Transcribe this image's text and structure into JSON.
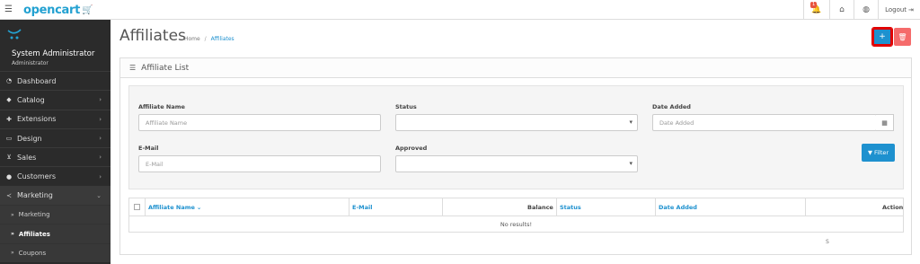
{
  "header": {
    "logo_text": "opencart",
    "notification_count": "1",
    "logout_label": "Logout"
  },
  "sidebar": {
    "profile_name": "System Administrator",
    "profile_role": "Administrator",
    "items": [
      {
        "label": "Dashboard",
        "icon": "dashboard-icon"
      },
      {
        "label": "Catalog",
        "icon": "tag-icon"
      },
      {
        "label": "Extensions",
        "icon": "puzzle-icon"
      },
      {
        "label": "Design",
        "icon": "monitor-icon"
      },
      {
        "label": "Sales",
        "icon": "cart-icon"
      },
      {
        "label": "Customers",
        "icon": "user-icon"
      },
      {
        "label": "Marketing",
        "icon": "share-icon"
      }
    ],
    "sub_items": [
      {
        "label": "Marketing"
      },
      {
        "label": "Affiliates"
      },
      {
        "label": "Coupons"
      }
    ]
  },
  "page": {
    "title": "Affiliates",
    "breadcrumb": [
      "Home",
      "Affiliates"
    ]
  },
  "panel": {
    "title": "Affiliate List"
  },
  "filters": {
    "affiliate_name_label": "Affiliate Name",
    "affiliate_name_placeholder": "Affiliate Name",
    "status_label": "Status",
    "date_added_label": "Date Added",
    "date_added_placeholder": "Date Added",
    "email_label": "E-Mail",
    "email_placeholder": "E-Mail",
    "approved_label": "Approved",
    "filter_button": "Filter"
  },
  "table": {
    "columns": [
      "Affiliate Name",
      "E-Mail",
      "Balance",
      "Status",
      "Date Added",
      "Action"
    ],
    "empty_text": "No results!"
  },
  "pagination": {
    "text": "S"
  },
  "colors": {
    "accent": "#1e91cf",
    "danger": "#f56b6b",
    "sidebar_bg": "#2b2b2b"
  }
}
